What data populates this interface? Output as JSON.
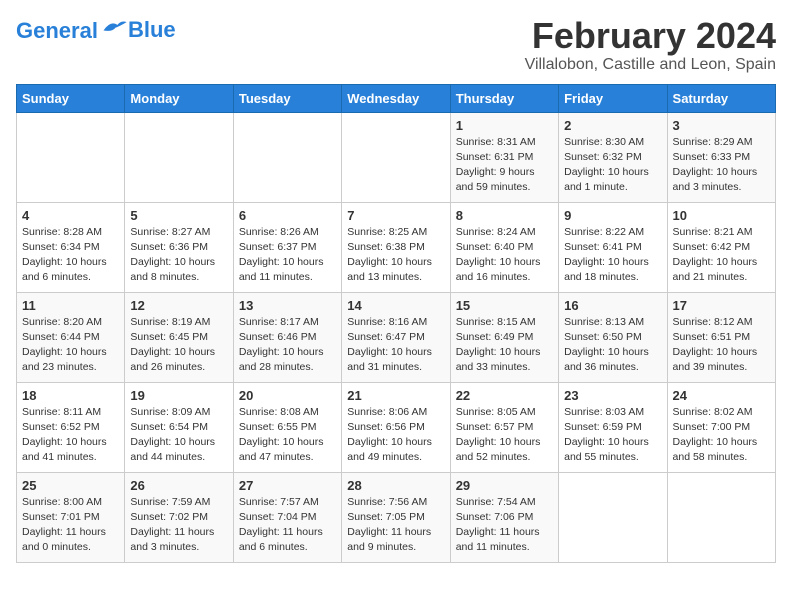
{
  "header": {
    "logo_line1": "General",
    "logo_line2": "Blue",
    "month_title": "February 2024",
    "location": "Villalobon, Castille and Leon, Spain"
  },
  "days_of_week": [
    "Sunday",
    "Monday",
    "Tuesday",
    "Wednesday",
    "Thursday",
    "Friday",
    "Saturday"
  ],
  "weeks": [
    [
      {
        "day": "",
        "info": ""
      },
      {
        "day": "",
        "info": ""
      },
      {
        "day": "",
        "info": ""
      },
      {
        "day": "",
        "info": ""
      },
      {
        "day": "1",
        "info": "Sunrise: 8:31 AM\nSunset: 6:31 PM\nDaylight: 9 hours\nand 59 minutes."
      },
      {
        "day": "2",
        "info": "Sunrise: 8:30 AM\nSunset: 6:32 PM\nDaylight: 10 hours\nand 1 minute."
      },
      {
        "day": "3",
        "info": "Sunrise: 8:29 AM\nSunset: 6:33 PM\nDaylight: 10 hours\nand 3 minutes."
      }
    ],
    [
      {
        "day": "4",
        "info": "Sunrise: 8:28 AM\nSunset: 6:34 PM\nDaylight: 10 hours\nand 6 minutes."
      },
      {
        "day": "5",
        "info": "Sunrise: 8:27 AM\nSunset: 6:36 PM\nDaylight: 10 hours\nand 8 minutes."
      },
      {
        "day": "6",
        "info": "Sunrise: 8:26 AM\nSunset: 6:37 PM\nDaylight: 10 hours\nand 11 minutes."
      },
      {
        "day": "7",
        "info": "Sunrise: 8:25 AM\nSunset: 6:38 PM\nDaylight: 10 hours\nand 13 minutes."
      },
      {
        "day": "8",
        "info": "Sunrise: 8:24 AM\nSunset: 6:40 PM\nDaylight: 10 hours\nand 16 minutes."
      },
      {
        "day": "9",
        "info": "Sunrise: 8:22 AM\nSunset: 6:41 PM\nDaylight: 10 hours\nand 18 minutes."
      },
      {
        "day": "10",
        "info": "Sunrise: 8:21 AM\nSunset: 6:42 PM\nDaylight: 10 hours\nand 21 minutes."
      }
    ],
    [
      {
        "day": "11",
        "info": "Sunrise: 8:20 AM\nSunset: 6:44 PM\nDaylight: 10 hours\nand 23 minutes."
      },
      {
        "day": "12",
        "info": "Sunrise: 8:19 AM\nSunset: 6:45 PM\nDaylight: 10 hours\nand 26 minutes."
      },
      {
        "day": "13",
        "info": "Sunrise: 8:17 AM\nSunset: 6:46 PM\nDaylight: 10 hours\nand 28 minutes."
      },
      {
        "day": "14",
        "info": "Sunrise: 8:16 AM\nSunset: 6:47 PM\nDaylight: 10 hours\nand 31 minutes."
      },
      {
        "day": "15",
        "info": "Sunrise: 8:15 AM\nSunset: 6:49 PM\nDaylight: 10 hours\nand 33 minutes."
      },
      {
        "day": "16",
        "info": "Sunrise: 8:13 AM\nSunset: 6:50 PM\nDaylight: 10 hours\nand 36 minutes."
      },
      {
        "day": "17",
        "info": "Sunrise: 8:12 AM\nSunset: 6:51 PM\nDaylight: 10 hours\nand 39 minutes."
      }
    ],
    [
      {
        "day": "18",
        "info": "Sunrise: 8:11 AM\nSunset: 6:52 PM\nDaylight: 10 hours\nand 41 minutes."
      },
      {
        "day": "19",
        "info": "Sunrise: 8:09 AM\nSunset: 6:54 PM\nDaylight: 10 hours\nand 44 minutes."
      },
      {
        "day": "20",
        "info": "Sunrise: 8:08 AM\nSunset: 6:55 PM\nDaylight: 10 hours\nand 47 minutes."
      },
      {
        "day": "21",
        "info": "Sunrise: 8:06 AM\nSunset: 6:56 PM\nDaylight: 10 hours\nand 49 minutes."
      },
      {
        "day": "22",
        "info": "Sunrise: 8:05 AM\nSunset: 6:57 PM\nDaylight: 10 hours\nand 52 minutes."
      },
      {
        "day": "23",
        "info": "Sunrise: 8:03 AM\nSunset: 6:59 PM\nDaylight: 10 hours\nand 55 minutes."
      },
      {
        "day": "24",
        "info": "Sunrise: 8:02 AM\nSunset: 7:00 PM\nDaylight: 10 hours\nand 58 minutes."
      }
    ],
    [
      {
        "day": "25",
        "info": "Sunrise: 8:00 AM\nSunset: 7:01 PM\nDaylight: 11 hours\nand 0 minutes."
      },
      {
        "day": "26",
        "info": "Sunrise: 7:59 AM\nSunset: 7:02 PM\nDaylight: 11 hours\nand 3 minutes."
      },
      {
        "day": "27",
        "info": "Sunrise: 7:57 AM\nSunset: 7:04 PM\nDaylight: 11 hours\nand 6 minutes."
      },
      {
        "day": "28",
        "info": "Sunrise: 7:56 AM\nSunset: 7:05 PM\nDaylight: 11 hours\nand 9 minutes."
      },
      {
        "day": "29",
        "info": "Sunrise: 7:54 AM\nSunset: 7:06 PM\nDaylight: 11 hours\nand 11 minutes."
      },
      {
        "day": "",
        "info": ""
      },
      {
        "day": "",
        "info": ""
      }
    ]
  ]
}
